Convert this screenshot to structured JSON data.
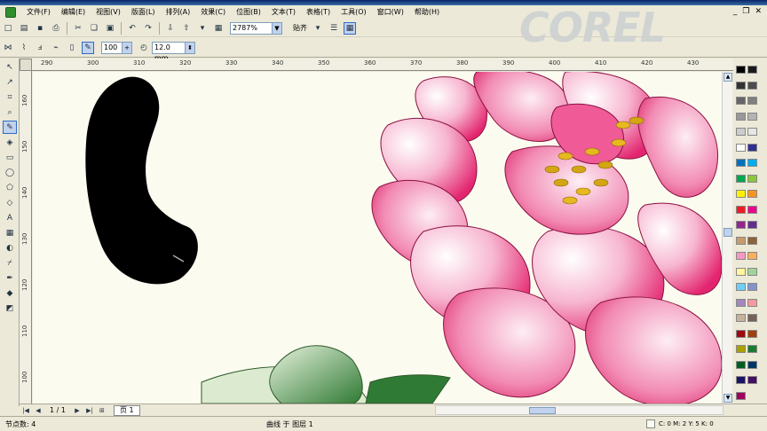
{
  "menu": [
    "文件(F)",
    "编辑(E)",
    "视图(V)",
    "版面(L)",
    "排列(A)",
    "效果(C)",
    "位图(B)",
    "文本(T)",
    "表格(T)",
    "工具(O)",
    "窗口(W)",
    "帮助(H)"
  ],
  "brand": "COREL",
  "toolbar": {
    "zoom": "2787%",
    "snap_label": "贴齐"
  },
  "property_bar": {
    "size_value": "100",
    "width_value": "12.0 mm"
  },
  "ruler": {
    "h_ticks": [
      "290",
      "300",
      "310",
      "320",
      "330",
      "340",
      "350",
      "360",
      "370",
      "380",
      "390",
      "400",
      "410",
      "420",
      "430"
    ],
    "v_ticks": [
      "160",
      "150",
      "140",
      "130",
      "120",
      "110",
      "100"
    ]
  },
  "pagebar": {
    "page_count": "1 / 1",
    "page_tab": "页 1"
  },
  "status": {
    "nodes": "节点数: 4",
    "object": "曲线 于 图层 1",
    "color_info": "C: 0 M: 2 Y: 5 K: 0"
  },
  "colors": {
    "palette": [
      "#000000",
      "#1a1a1a",
      "#333333",
      "#4d4d4d",
      "#666666",
      "#808080",
      "#999999",
      "#b3b3b3",
      "#cccccc",
      "#e6e6e6",
      "#ffffff",
      "#2e3192",
      "#0072bc",
      "#00aeef",
      "#00a651",
      "#8dc63f",
      "#fff200",
      "#f7941d",
      "#ed1c24",
      "#ec008c",
      "#92278f",
      "#662d91",
      "#c69c6d",
      "#8c6239",
      "#f49ac1",
      "#fbaf5d",
      "#fff799",
      "#a2d39c",
      "#6dcff6",
      "#8493ca",
      "#a187be",
      "#f6989d",
      "#c7b299",
      "#736357",
      "#9e0b0f",
      "#a0410d",
      "#aba000",
      "#1a7b30",
      "#005e20",
      "#003663",
      "#1b1464",
      "#440e62",
      "#9e005d"
    ]
  }
}
